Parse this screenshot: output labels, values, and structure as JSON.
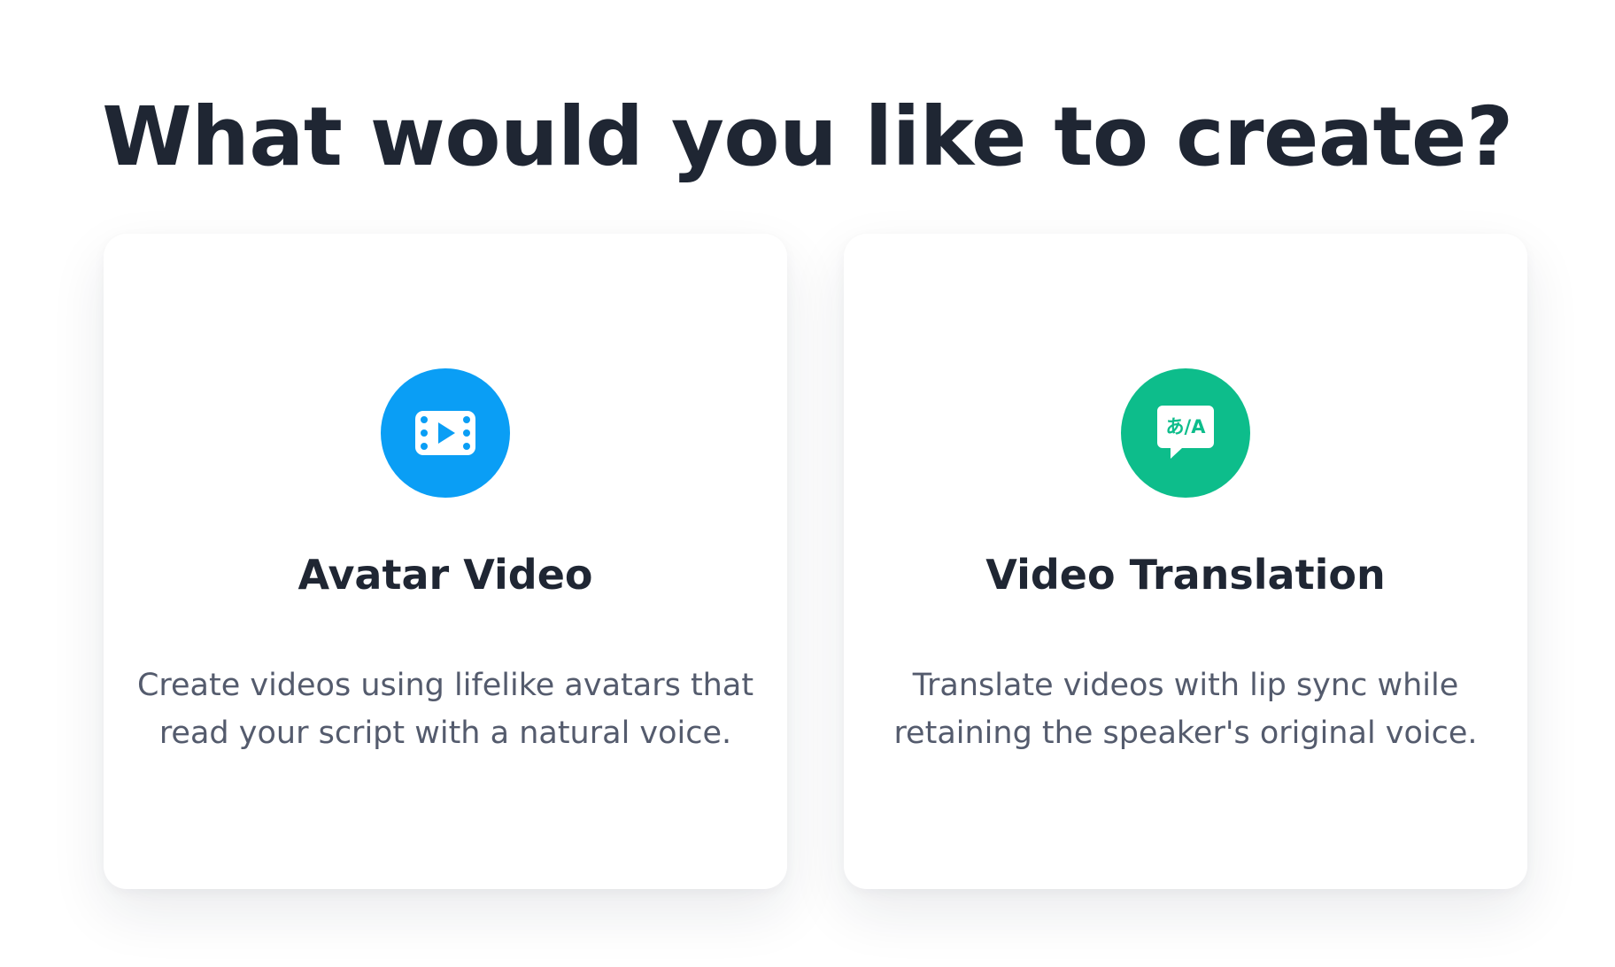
{
  "header": {
    "title": "What would you like to create?"
  },
  "options": [
    {
      "title": "Avatar Video",
      "description": "Create videos using lifelike avatars that read your script with a natural voice.",
      "icon": "video-play-icon",
      "icon_color": "#0a9ef5"
    },
    {
      "title": "Video Translation",
      "description": "Translate videos with lip sync while retaining the speaker's original voice.",
      "icon": "translate-icon",
      "icon_text": "あ/A",
      "icon_color": "#0dbd8b"
    }
  ]
}
